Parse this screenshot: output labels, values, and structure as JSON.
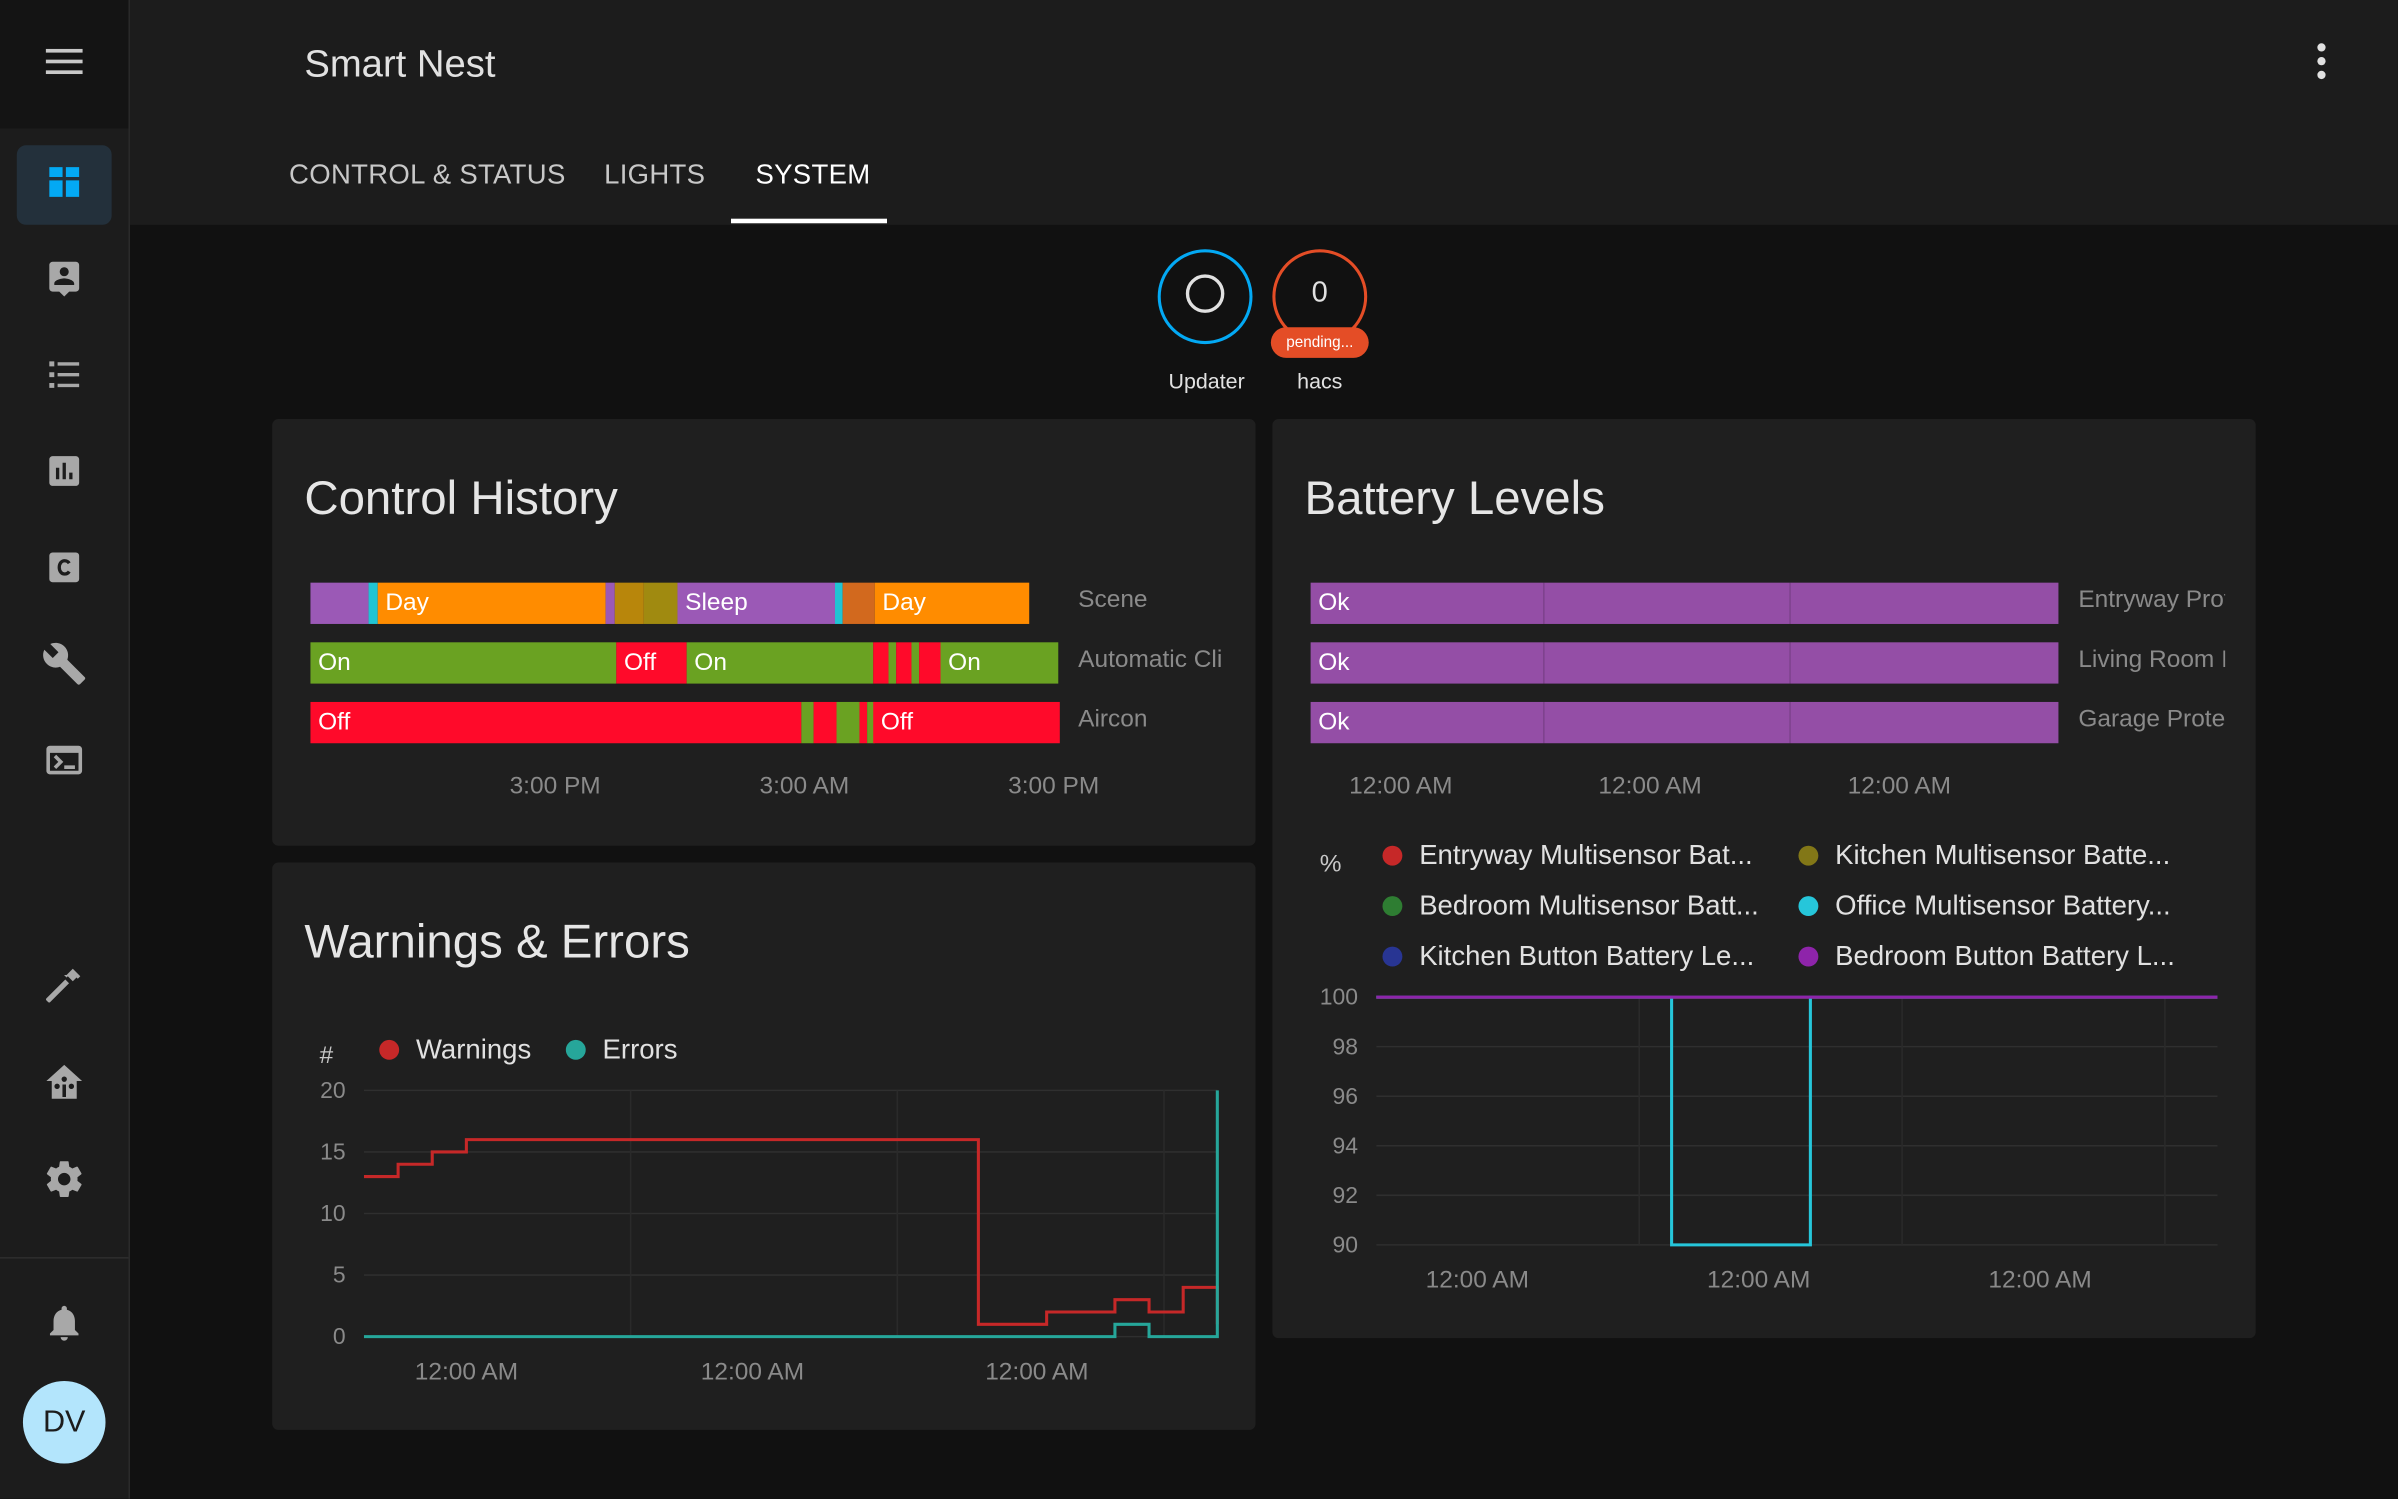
{
  "app": {
    "title": "Smart Nest"
  },
  "user": {
    "initials": "DV"
  },
  "sidebar": {
    "items": [
      {
        "icon": "dashboard-icon",
        "active": true
      },
      {
        "icon": "person-card-icon"
      },
      {
        "icon": "list-icon"
      },
      {
        "icon": "bar-chart-icon"
      },
      {
        "icon": "hacs-icon"
      },
      {
        "icon": "wrench-icon"
      },
      {
        "icon": "terminal-icon"
      },
      {
        "icon": "hammer-icon"
      },
      {
        "icon": "home-assistant-icon"
      },
      {
        "icon": "gear-icon"
      },
      {
        "icon": "bell-icon"
      }
    ]
  },
  "tabs": [
    {
      "label": "CONTROL & STATUS"
    },
    {
      "label": "LIGHTS"
    },
    {
      "label": "SYSTEM",
      "active": true
    }
  ],
  "badges": {
    "updater": {
      "label": "Updater",
      "color": "#03a9f4"
    },
    "hacs": {
      "label": "hacs",
      "value": "0",
      "pill": "pending...",
      "color": "#e44d26"
    }
  },
  "control_history": {
    "title": "Control History",
    "rows": [
      {
        "name": "Scene",
        "segments": [
          {
            "color": "#9b59b6",
            "w": 0.078,
            "text": ""
          },
          {
            "color": "#20c4d3",
            "w": 0.012,
            "text": ""
          },
          {
            "color": "#ff8c00",
            "w": 0.305,
            "text": "Day"
          },
          {
            "color": "#9b59b6",
            "w": 0.012,
            "text": ""
          },
          {
            "color": "#b8860b",
            "w": 0.038,
            "text": ""
          },
          {
            "color": "#a08a10",
            "w": 0.045,
            "text": ""
          },
          {
            "color": "#9b59b6",
            "w": 0.21,
            "text": "Sleep"
          },
          {
            "color": "#20c4d3",
            "w": 0.01,
            "text": ""
          },
          {
            "color": "#d2691e",
            "w": 0.043,
            "text": ""
          },
          {
            "color": "#ff8c00",
            "w": 0.207,
            "text": "Day"
          }
        ]
      },
      {
        "name": "Automatic Cli",
        "segments": [
          {
            "color": "#6aa222",
            "w": 0.41,
            "text": "On"
          },
          {
            "color": "#ff0a2a",
            "w": 0.095,
            "text": "Off"
          },
          {
            "color": "#6aa222",
            "w": 0.25,
            "text": "On"
          },
          {
            "color": "#ff0a2a",
            "w": 0.02,
            "text": ""
          },
          {
            "color": "#6aa222",
            "w": 0.01,
            "text": ""
          },
          {
            "color": "#ff0a2a",
            "w": 0.02,
            "text": ""
          },
          {
            "color": "#6aa222",
            "w": 0.01,
            "text": ""
          },
          {
            "color": "#ff0a2a",
            "w": 0.028,
            "text": ""
          },
          {
            "color": "#6aa222",
            "w": 0.157,
            "text": "On"
          }
        ]
      },
      {
        "name": "Aircon",
        "segments": [
          {
            "color": "#ff0a2a",
            "w": 0.657,
            "text": "Off"
          },
          {
            "color": "#6aa222",
            "w": 0.016,
            "text": ""
          },
          {
            "color": "#ff0a2a",
            "w": 0.03,
            "text": ""
          },
          {
            "color": "#6aa222",
            "w": 0.03,
            "text": ""
          },
          {
            "color": "#ff0a2a",
            "w": 0.01,
            "text": ""
          },
          {
            "color": "#6aa222",
            "w": 0.008,
            "text": ""
          },
          {
            "color": "#ff0a2a",
            "w": 0.249,
            "text": "Off"
          }
        ]
      }
    ],
    "ticks": [
      "3:00 PM",
      "3:00 AM",
      "3:00 PM"
    ]
  },
  "battery_timeline": {
    "title": "Battery Levels",
    "rows": [
      {
        "name": "Entryway Prot",
        "state": "Ok"
      },
      {
        "name": "Living Room I",
        "state": "Ok"
      },
      {
        "name": "Garage Prote",
        "state": "Ok"
      }
    ],
    "ticks": [
      "12:00 AM",
      "12:00 AM",
      "12:00 AM"
    ]
  },
  "chart_data": [
    {
      "type": "line",
      "title": "Warnings & Errors",
      "ylabel": "#",
      "ylim": [
        0,
        20
      ],
      "yticks": [
        0,
        5,
        10,
        15,
        20
      ],
      "xticks": [
        "12:00 AM",
        "12:00 AM",
        "12:00 AM"
      ],
      "x": [
        0,
        4,
        8,
        12,
        16,
        20,
        24,
        28,
        32,
        36,
        40,
        44,
        48,
        52,
        56,
        60,
        64,
        68,
        72,
        76,
        80,
        84,
        88,
        92,
        96,
        100
      ],
      "series": [
        {
          "name": "Warnings",
          "color": "#c62828",
          "values": [
            13,
            14,
            15,
            16,
            16,
            16,
            16,
            16,
            16,
            16,
            16,
            16,
            16,
            16,
            16,
            16,
            16,
            16,
            1,
            1,
            2,
            2,
            3,
            2,
            4,
            1
          ]
        },
        {
          "name": "Errors",
          "color": "#26a69a",
          "values": [
            0,
            0,
            0,
            0,
            0,
            0,
            0,
            0,
            0,
            0,
            0,
            0,
            0,
            0,
            0,
            0,
            0,
            0,
            0,
            0,
            0,
            0,
            1,
            0,
            0,
            20
          ]
        }
      ]
    },
    {
      "type": "line",
      "ylabel": "%",
      "ylim": [
        90,
        100
      ],
      "yticks": [
        90,
        92,
        94,
        96,
        98,
        100
      ],
      "xticks": [
        "12:00 AM",
        "12:00 AM",
        "12:00 AM"
      ],
      "x": [
        0,
        35,
        35.1,
        51.5,
        51.6,
        100
      ],
      "series": [
        {
          "name": "Entryway Multisensor Bat...",
          "color": "#c62828",
          "values": [
            100,
            100,
            100,
            100,
            100,
            100
          ]
        },
        {
          "name": "Kitchen Multisensor Batte...",
          "color": "#827717",
          "values": [
            100,
            100,
            100,
            100,
            100,
            100
          ]
        },
        {
          "name": "Bedroom Multisensor Batt...",
          "color": "#2e7d32",
          "values": [
            100,
            100,
            100,
            100,
            100,
            100
          ]
        },
        {
          "name": "Office Multisensor Battery...",
          "color": "#26c6da",
          "values": [
            100,
            100,
            90,
            90,
            100,
            100
          ]
        },
        {
          "name": "Kitchen Button Battery Le...",
          "color": "#283593",
          "values": [
            100,
            100,
            100,
            100,
            100,
            100
          ]
        },
        {
          "name": "Bedroom Button Battery L...",
          "color": "#8e24aa",
          "values": [
            100,
            100,
            100,
            100,
            100,
            100
          ]
        }
      ]
    }
  ]
}
